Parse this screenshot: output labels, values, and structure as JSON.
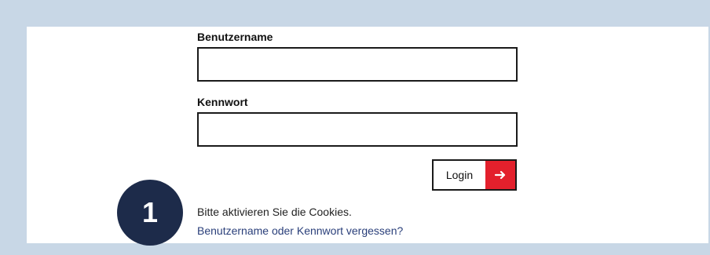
{
  "form": {
    "username_label": "Benutzername",
    "username_value": "",
    "password_label": "Kennwort",
    "password_value": "",
    "login_button_label": "Login",
    "login_arrow_icon": "arrow-right-icon",
    "cookie_notice": "Bitte aktivieren Sie die Cookies.",
    "forgot_link": "Benutzername oder Kennwort vergessen?"
  },
  "callout": {
    "number": "1"
  },
  "colors": {
    "background": "#c8d7e6",
    "panel": "#ffffff",
    "accent_red": "#e3202c",
    "badge_navy": "#1d2b4a",
    "link_blue": "#2a3f7a"
  }
}
